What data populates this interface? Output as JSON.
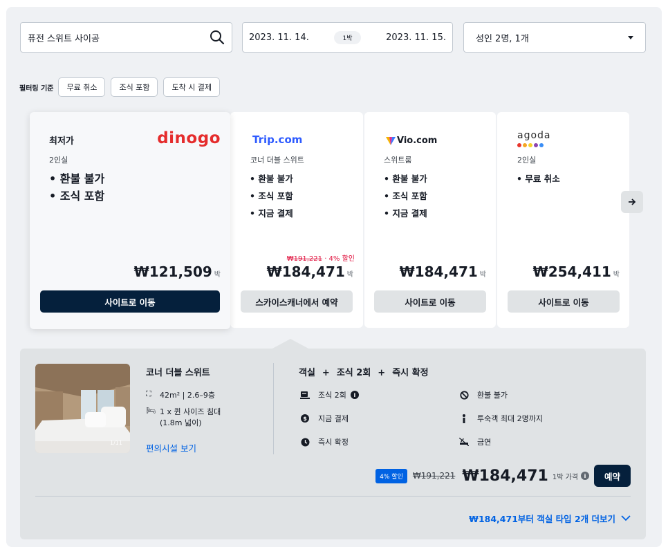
{
  "search": {
    "destination": "퓨전 스위트 사이공",
    "check_in": "2023. 11. 14.",
    "nights": "1박",
    "check_out": "2023. 11. 15.",
    "guests": "성인 2명, 1개"
  },
  "filters": {
    "label": "필터링 기준",
    "chips": [
      "무료 취소",
      "조식 포함",
      "도착 시 결제"
    ]
  },
  "best": {
    "title": "최저가",
    "logo": "dinogo",
    "subtitle": "2인실",
    "features": [
      "환불 불가",
      "조식 포함"
    ],
    "price": "₩121,509",
    "unit": "박",
    "button": "사이트로 이동"
  },
  "offers": [
    {
      "logo": "Trip.com",
      "subtitle": "코너 더블 스위트",
      "features": [
        "환불 불가",
        "조식 포함",
        "지금 결제"
      ],
      "old_price": "₩191,221",
      "discount": " · 4% 할인",
      "price": "₩184,471",
      "unit": "박",
      "button": "스카이스캐너에서 예약"
    },
    {
      "logo": "Vio.com",
      "subtitle": "스위트룸",
      "features": [
        "환불 불가",
        "조식 포함",
        "지금 결제"
      ],
      "price": "₩184,471",
      "unit": "박",
      "button": "사이트로 이동"
    },
    {
      "logo": "agoda",
      "subtitle": "2인실",
      "features": [
        "무료 취소"
      ],
      "price": "₩254,411",
      "unit": "박",
      "button": "사이트로 이동"
    }
  ],
  "room": {
    "photo_counter": "1/11",
    "name": "코너 더블 스위트",
    "size": "42m² | 2.6–9층",
    "bed_line1": "1 x 퀸 사이즈 침대",
    "bed_line2": "(1.8m 넓이)",
    "amenities_link": "편의시설 보기",
    "combo": [
      "객실",
      "조식 2회",
      "즉시 확정"
    ],
    "plus": "+",
    "amenities": [
      "조식 2회",
      "지금 결제",
      "즉시 확정",
      "환불 불가",
      "투숙객 최대 2명까지",
      "금연"
    ],
    "discount_badge": "4% 할인",
    "old_price": "₩191,221",
    "price": "₩184,471",
    "price_unit": "1박 가격",
    "reserve": "예약",
    "more": "₩184,471부터 객실 타입 2개 더보기"
  },
  "colors": {
    "navy": "#05203c",
    "blue": "#0062e3",
    "dinogo_red": "#e52c2c",
    "sale_red": "#e0123e",
    "panel": "#eff1f4"
  }
}
